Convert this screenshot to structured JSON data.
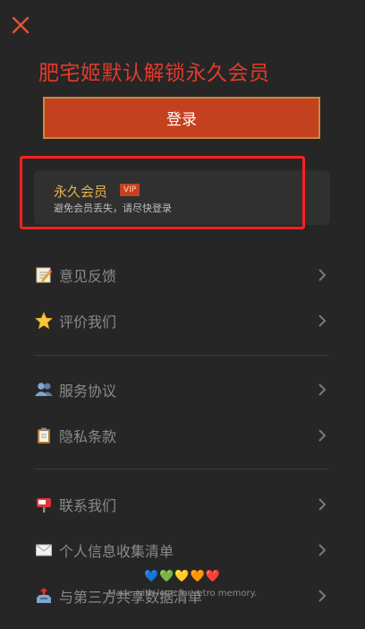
{
  "header": {
    "close_icon": "close-icon",
    "title": "肥宅姬默认解锁永久会员"
  },
  "login_button": {
    "label": "登录"
  },
  "vip_card": {
    "title": "永久会员",
    "badge": "VIP",
    "subtitle": "避免会员丢失，请尽快登录"
  },
  "menu": {
    "group1": [
      {
        "label": "意见反馈",
        "icon": "memo-icon"
      },
      {
        "label": "评价我们",
        "icon": "star-icon"
      }
    ],
    "group2": [
      {
        "label": "服务协议",
        "icon": "people-icon"
      },
      {
        "label": "隐私条款",
        "icon": "clipboard-icon"
      }
    ],
    "group3": [
      {
        "label": "联系我们",
        "icon": "mailbox-icon"
      },
      {
        "label": "个人信息收集清单",
        "icon": "envelope-icon"
      },
      {
        "label": "与第三方共享数据清单",
        "icon": "outbox-icon"
      }
    ]
  },
  "footer": {
    "hearts": "💙💚💛🧡❤️",
    "text": "Made with love for retro memory."
  },
  "colors": {
    "background": "#262626",
    "accent": "#c4411f",
    "title_red": "#e23a2a",
    "vip_gold": "#e6b34f"
  }
}
